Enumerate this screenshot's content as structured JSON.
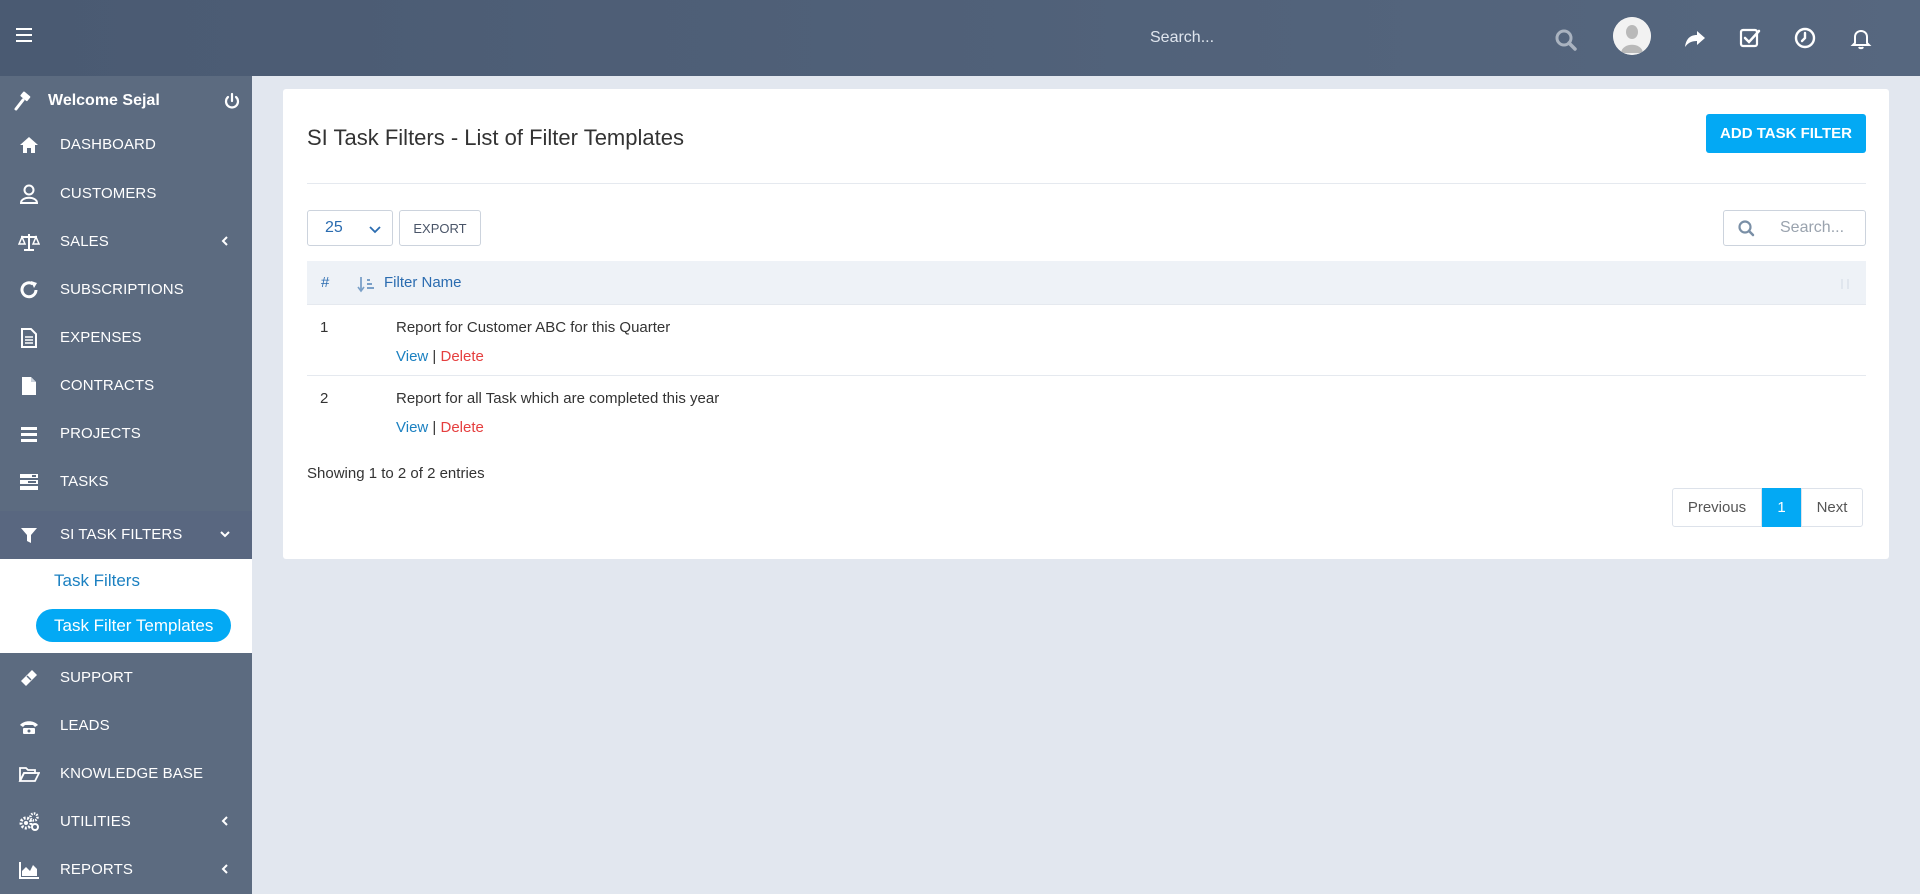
{
  "header": {
    "search_placeholder": "Search...",
    "icons": [
      "menu-icon",
      "search-icon",
      "avatar",
      "share-icon",
      "check-square-icon",
      "clock-icon",
      "bell-icon"
    ]
  },
  "sidebar": {
    "welcome": "Welcome Sejal",
    "items": [
      {
        "label": "DASHBOARD",
        "icon": "home-icon"
      },
      {
        "label": "CUSTOMERS",
        "icon": "user-icon"
      },
      {
        "label": "SALES",
        "icon": "scale-icon"
      },
      {
        "label": "SUBSCRIPTIONS",
        "icon": "refresh-icon"
      },
      {
        "label": "EXPENSES",
        "icon": "document-icon"
      },
      {
        "label": "CONTRACTS",
        "icon": "file-icon"
      },
      {
        "label": "PROJECTS",
        "icon": "bars-icon"
      },
      {
        "label": "TASKS",
        "icon": "tasks-icon"
      },
      {
        "label": "SI TASK FILTERS",
        "icon": "filter-icon"
      },
      {
        "label": "SUPPORT",
        "icon": "ticket-icon"
      },
      {
        "label": "LEADS",
        "icon": "phone-icon"
      },
      {
        "label": "KNOWLEDGE BASE",
        "icon": "folder-open-icon"
      },
      {
        "label": "UTILITIES",
        "icon": "cogs-icon"
      },
      {
        "label": "REPORTS",
        "icon": "area-chart-icon"
      }
    ],
    "submenu": {
      "task_filters": "Task Filters",
      "task_filter_templates": "Task Filter Templates"
    }
  },
  "main": {
    "title": "SI Task Filters - List of Filter Templates",
    "add_button": "ADD TASK FILTER",
    "page_length": "25",
    "export_label": "EXPORT",
    "search_placeholder": "Search...",
    "columns": {
      "hash": "#",
      "filter_name": "Filter Name"
    },
    "rows": [
      {
        "num": "1",
        "name": "Report for Customer ABC for this Quarter",
        "view": "View",
        "sep": "|",
        "delete": "Delete"
      },
      {
        "num": "2",
        "name": "Report for all Task which are completed this year",
        "view": "View",
        "sep": "|",
        "delete": "Delete"
      }
    ],
    "info": "Showing 1 to 2 of 2 entries",
    "pagination": {
      "previous": "Previous",
      "current": "1",
      "next": "Next"
    }
  },
  "colors": {
    "accent": "#03a9f4",
    "sidebar": "#5c6b80",
    "header": "#4e5e75",
    "delete": "#e53e3e",
    "link": "#1b80c1"
  }
}
